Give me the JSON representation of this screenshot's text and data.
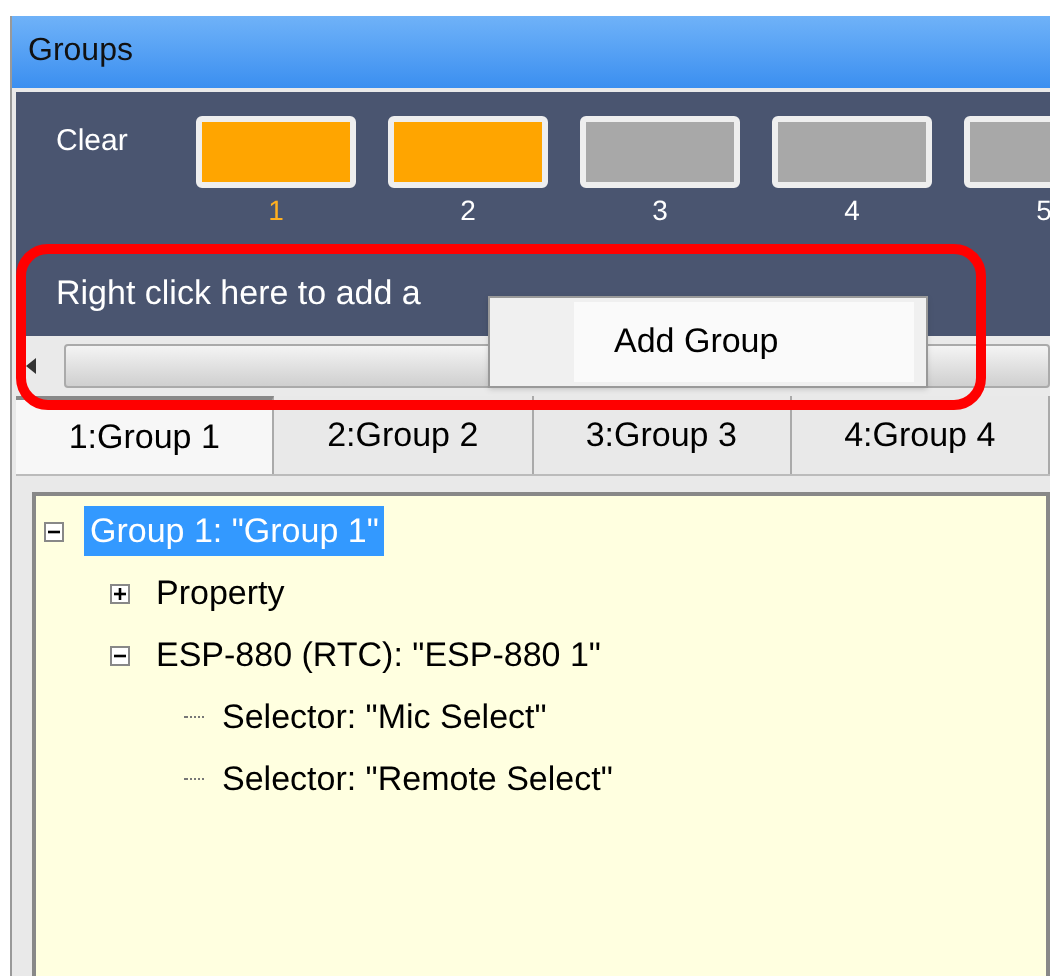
{
  "window": {
    "title": "Groups"
  },
  "clear_label": "Clear",
  "group_buttons": [
    {
      "label": "1",
      "selected": true
    },
    {
      "label": "2",
      "selected": true
    },
    {
      "label": "3",
      "selected": false
    },
    {
      "label": "4",
      "selected": false
    },
    {
      "label": "5",
      "selected": false
    }
  ],
  "hint": "Right click here to add a",
  "context_menu": {
    "items": [
      "Add Group"
    ]
  },
  "tabs": [
    {
      "label": "1:Group 1",
      "selected": true
    },
    {
      "label": "2:Group 2",
      "selected": false
    },
    {
      "label": "3:Group 3",
      "selected": false
    },
    {
      "label": "4:Group 4",
      "selected": false
    }
  ],
  "tree": [
    {
      "label": "Group 1: \"Group 1\"",
      "selected": true,
      "expanded": true,
      "children": [
        {
          "label": "Property",
          "selected": false,
          "expanded": false
        },
        {
          "label": "ESP-880 (RTC): \"ESP-880 1\"",
          "selected": false,
          "expanded": true,
          "children": [
            {
              "label": "Selector: \"Mic Select\"",
              "selected": false
            },
            {
              "label": "Selector: \"Remote Select\"",
              "selected": false
            }
          ]
        }
      ]
    }
  ]
}
